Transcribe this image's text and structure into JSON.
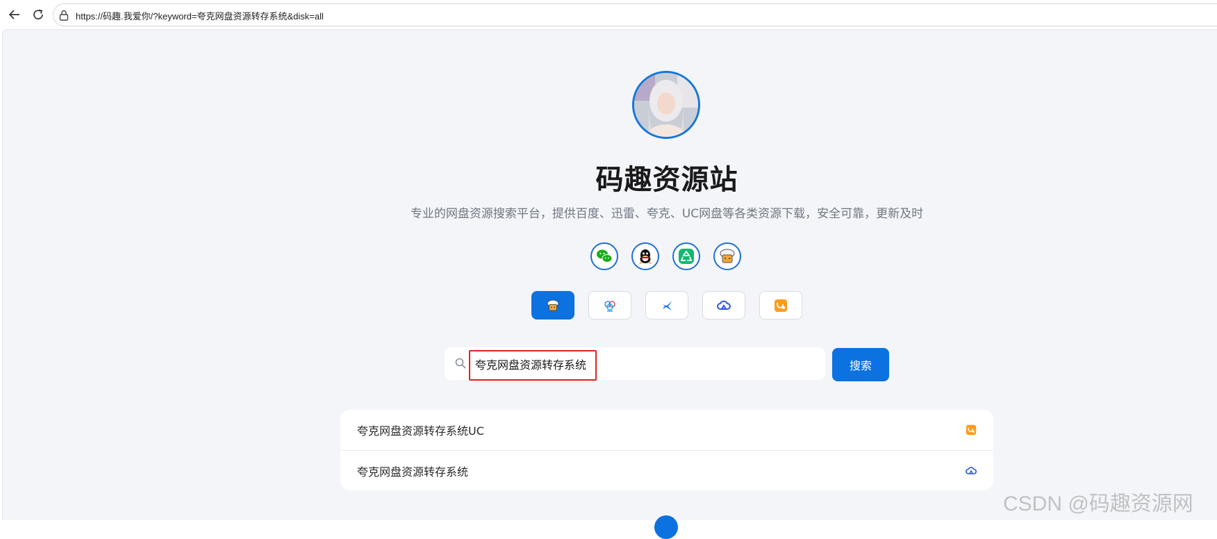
{
  "browser": {
    "url": "https://码趣.我爱你/?keyword=夸克网盘资源转存系统&disk=all",
    "back_icon": "arrow-left-icon",
    "reload_icon": "reload-icon",
    "lock_icon": "lock-icon"
  },
  "page": {
    "avatar": "avatar-image",
    "title": "码趣资源站",
    "subtitle": "专业的网盘资源搜索平台，提供百度、迅雷、夸克、UC网盘等各类资源下载，安全可靠，更新及时",
    "social_links": [
      {
        "icon": "wechat-icon"
      },
      {
        "icon": "qq-icon"
      },
      {
        "icon": "recycle-icon"
      },
      {
        "icon": "mascot-icon"
      }
    ],
    "disk_filters": [
      {
        "icon": "all-disk-icon",
        "active": true
      },
      {
        "icon": "baidu-disk-icon",
        "active": false
      },
      {
        "icon": "xunlei-disk-icon",
        "active": false
      },
      {
        "icon": "quark-disk-icon",
        "active": false
      },
      {
        "icon": "uc-disk-icon",
        "active": false
      }
    ],
    "search": {
      "value": "夸克网盘资源转存系统",
      "button_label": "搜索",
      "icon": "search-icon"
    },
    "results": [
      {
        "title": "夸克网盘资源转存系统UC",
        "icon": "uc-disk-icon"
      },
      {
        "title": "夸克网盘资源转存系统",
        "icon": "quark-disk-icon"
      }
    ]
  },
  "watermark": "CSDN @码趣资源网",
  "colors": {
    "accent": "#0b72e0",
    "background": "#f3f5f9",
    "highlight": "#e02020"
  }
}
